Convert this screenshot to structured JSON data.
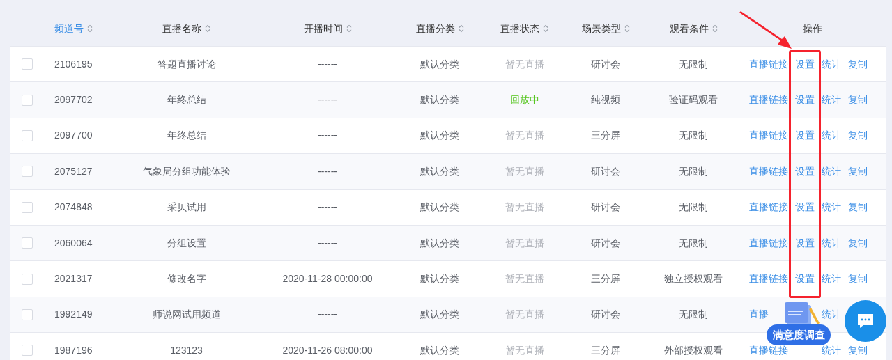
{
  "table": {
    "columns": [
      {
        "label": "频道号",
        "sorted": true
      },
      {
        "label": "直播名称",
        "sorted": false
      },
      {
        "label": "开播时间",
        "sorted": false
      },
      {
        "label": "直播分类",
        "sorted": false
      },
      {
        "label": "直播状态",
        "sorted": false
      },
      {
        "label": "场景类型",
        "sorted": false
      },
      {
        "label": "观看条件",
        "sorted": false
      },
      {
        "label": "操作"
      }
    ],
    "rows": [
      {
        "checked": false,
        "id": "2106195",
        "name": "答题直播讨论",
        "time": "------",
        "category": "默认分类",
        "status": {
          "label": "暂无直播",
          "kind": "idle"
        },
        "scene": "研讨会",
        "condition": "无限制",
        "actions": {
          "link": "直播链接",
          "settings": "设置",
          "stats": "统计",
          "copy": "复制"
        }
      },
      {
        "checked": false,
        "id": "2097702",
        "name": "年终总结",
        "time": "------",
        "category": "默认分类",
        "status": {
          "label": "回放中",
          "kind": "replay"
        },
        "scene": "纯视频",
        "condition": "验证码观看",
        "actions": {
          "link": "直播链接",
          "settings": "设置",
          "stats": "统计",
          "copy": "复制"
        }
      },
      {
        "checked": false,
        "id": "2097700",
        "name": "年终总结",
        "time": "------",
        "category": "默认分类",
        "status": {
          "label": "暂无直播",
          "kind": "idle"
        },
        "scene": "三分屏",
        "condition": "无限制",
        "actions": {
          "link": "直播链接",
          "settings": "设置",
          "stats": "统计",
          "copy": "复制"
        }
      },
      {
        "checked": false,
        "id": "2075127",
        "name": "气象局分组功能体验",
        "time": "------",
        "category": "默认分类",
        "status": {
          "label": "暂无直播",
          "kind": "idle"
        },
        "scene": "研讨会",
        "condition": "无限制",
        "actions": {
          "link": "直播链接",
          "settings": "设置",
          "stats": "统计",
          "copy": "复制"
        }
      },
      {
        "checked": false,
        "id": "2074848",
        "name": "采贝试用",
        "time": "------",
        "category": "默认分类",
        "status": {
          "label": "暂无直播",
          "kind": "idle"
        },
        "scene": "研讨会",
        "condition": "无限制",
        "actions": {
          "link": "直播链接",
          "settings": "设置",
          "stats": "统计",
          "copy": "复制"
        }
      },
      {
        "checked": false,
        "id": "2060064",
        "name": "分组设置",
        "time": "------",
        "category": "默认分类",
        "status": {
          "label": "暂无直播",
          "kind": "idle"
        },
        "scene": "研讨会",
        "condition": "无限制",
        "actions": {
          "link": "直播链接",
          "settings": "设置",
          "stats": "统计",
          "copy": "复制"
        }
      },
      {
        "checked": false,
        "id": "2021317",
        "name": "修改名字",
        "time": "2020-11-28 00:00:00",
        "category": "默认分类",
        "status": {
          "label": "暂无直播",
          "kind": "idle"
        },
        "scene": "三分屏",
        "condition": "独立授权观看",
        "actions": {
          "link": "直播链接",
          "settings": "设置",
          "stats": "统计",
          "copy": "复制"
        }
      },
      {
        "checked": false,
        "id": "1992149",
        "name": "师说网试用频道",
        "time": "------",
        "category": "默认分类",
        "status": {
          "label": "暂无直播",
          "kind": "idle"
        },
        "scene": "研讨会",
        "condition": "无限制",
        "actions": {
          "link": "直播",
          "stats": "统计"
        }
      },
      {
        "checked": false,
        "id": "1987196",
        "name": "123123",
        "time": "2020-11-26 08:00:00",
        "category": "默认分类",
        "status": {
          "label": "暂无直播",
          "kind": "idle"
        },
        "scene": "三分屏",
        "condition": "外部授权观看",
        "actions": {
          "link": "直播链接",
          "stats": "统计",
          "copy": "复制"
        }
      }
    ]
  },
  "survey_badge": {
    "label": "满意度调查"
  }
}
